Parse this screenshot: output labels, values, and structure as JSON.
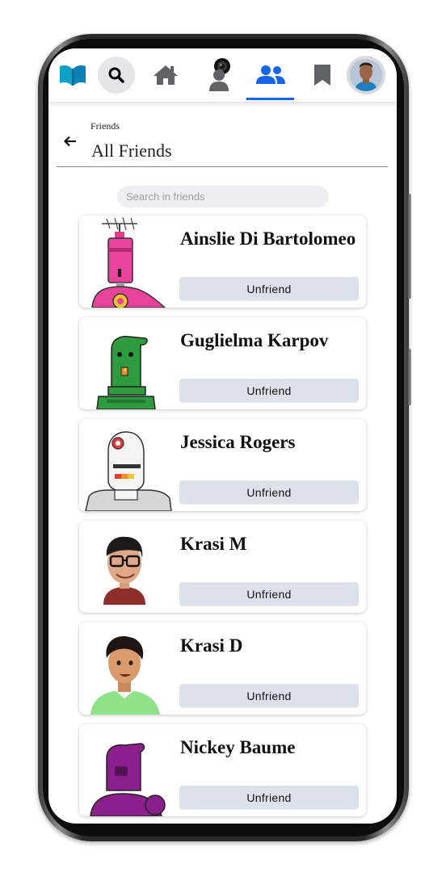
{
  "nav": {
    "items": [
      {
        "icon": "book-logo-icon"
      },
      {
        "icon": "search-icon"
      },
      {
        "icon": "home-icon"
      },
      {
        "icon": "user-webcam-icon"
      },
      {
        "icon": "friends-icon",
        "active": true
      },
      {
        "icon": "bookmark-icon"
      },
      {
        "icon": "profile-avatar"
      }
    ],
    "accent_color": "#1565e6"
  },
  "header": {
    "breadcrumb": "Friends",
    "title": "All Friends"
  },
  "search": {
    "placeholder": "Search in friends",
    "value": ""
  },
  "friends": [
    {
      "name": "Ainslie Di Bartolomeo",
      "action": "Unfriend",
      "avatar": "pink-robot-antenna"
    },
    {
      "name": "Guglielma Karpov",
      "action": "Unfriend",
      "avatar": "green-robot"
    },
    {
      "name": "Jessica Rogers",
      "action": "Unfriend",
      "avatar": "white-robot"
    },
    {
      "name": "Krasi M",
      "action": "Unfriend",
      "avatar": "man-glasses"
    },
    {
      "name": "Krasi D",
      "action": "Unfriend",
      "avatar": "man-green-shirt"
    },
    {
      "name": "Nickey Baume",
      "action": "Unfriend",
      "avatar": "purple-robot"
    }
  ]
}
